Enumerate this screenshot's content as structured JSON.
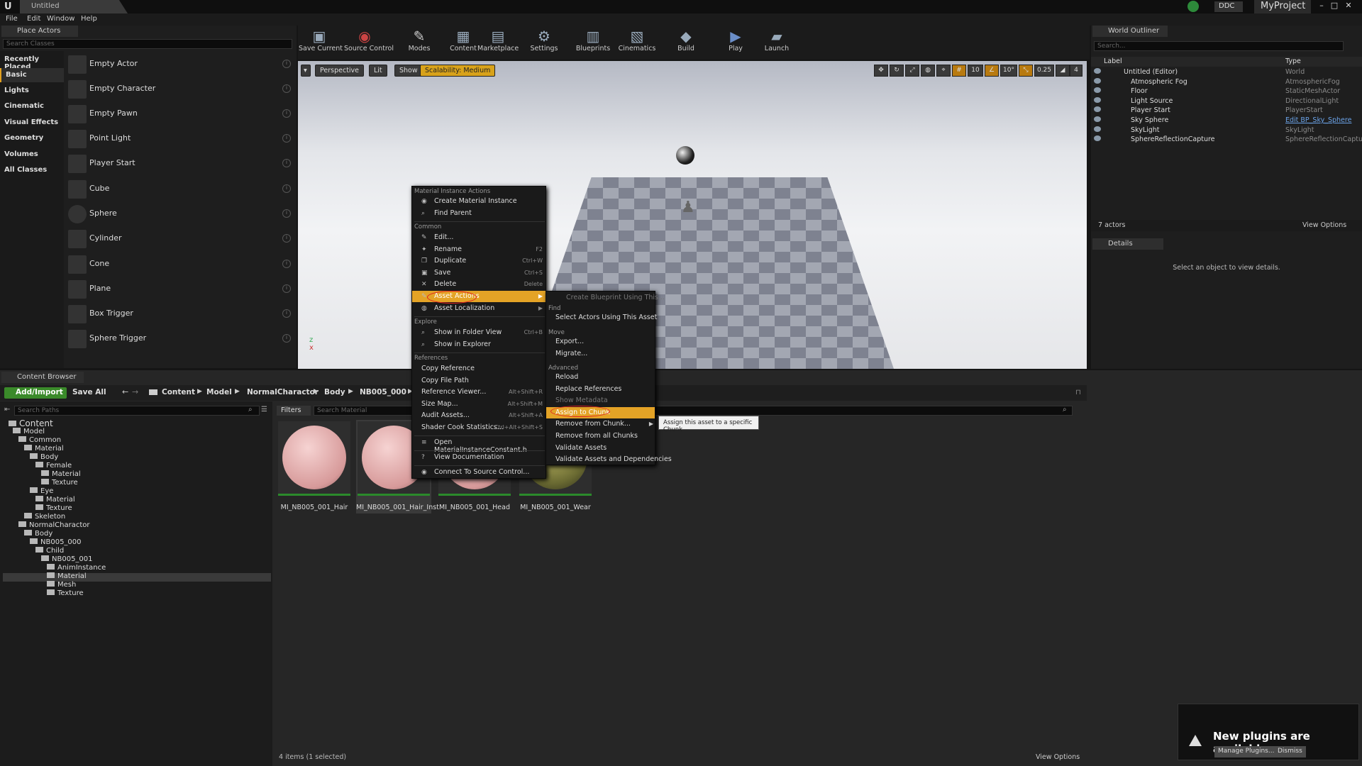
{
  "window": {
    "doc_tab": "Untitled",
    "ddc": "DDC",
    "project": "MyProject"
  },
  "menubar": [
    "File",
    "Edit",
    "Window",
    "Help"
  ],
  "place_actors": {
    "tab": "Place Actors",
    "search_placeholder": "Search Classes",
    "categories": [
      "Recently Placed",
      "Basic",
      "Lights",
      "Cinematic",
      "Visual Effects",
      "Geometry",
      "Volumes",
      "All Classes"
    ],
    "items": [
      "Empty Actor",
      "Empty Character",
      "Empty Pawn",
      "Point Light",
      "Player Start",
      "Cube",
      "Sphere",
      "Cylinder",
      "Cone",
      "Plane",
      "Box Trigger",
      "Sphere Trigger"
    ]
  },
  "toolbar": [
    "Save Current",
    "Source Control",
    "Modes",
    "Content",
    "Marketplace",
    "Settings",
    "Blueprints",
    "Cinematics",
    "Build",
    "Play",
    "Launch"
  ],
  "viewport": {
    "perspective": "Perspective",
    "lit": "Lit",
    "show": "Show",
    "scalability": "Scalability: Medium",
    "right": [
      "10",
      "10°",
      "0.25",
      "4"
    ]
  },
  "outliner": {
    "tab": "World Outliner",
    "search_placeholder": "Search...",
    "col_label": "Label",
    "col_type": "Type",
    "rows": [
      {
        "name": "Untitled (Editor)",
        "type": "World"
      },
      {
        "name": "Atmospheric Fog",
        "type": "AtmosphericFog"
      },
      {
        "name": "Floor",
        "type": "StaticMeshActor"
      },
      {
        "name": "Light Source",
        "type": "DirectionalLight"
      },
      {
        "name": "Player Start",
        "type": "PlayerStart"
      },
      {
        "name": "Sky Sphere",
        "type": "Edit BP_Sky_Sphere"
      },
      {
        "name": "SkyLight",
        "type": "SkyLight"
      },
      {
        "name": "SphereReflectionCapture",
        "type": "SphereReflectionCapture"
      }
    ],
    "count": "7 actors",
    "view_options": "View Options"
  },
  "details": {
    "tab": "Details",
    "message": "Select an object to view details."
  },
  "content_browser": {
    "tab": "Content Browser",
    "add_import": "Add/Import",
    "save_all": "Save All",
    "breadcrumb": [
      "Content",
      "Model",
      "NormalCharactor",
      "Body",
      "NB005_000"
    ],
    "tree_search_placeholder": "Search Paths",
    "filters": "Filters",
    "asset_search_placeholder": "Search Material",
    "tree": [
      "Content",
      "Model",
      "Common",
      "Material",
      "Body",
      "Female",
      "Material",
      "Texture",
      "Eye",
      "Material",
      "Texture",
      "Skeleton",
      "NormalCharactor",
      "Body",
      "NB005_000",
      "Child",
      "NB005_001",
      "AnimInstance",
      "Material",
      "Mesh",
      "Texture"
    ],
    "assets": [
      "MI_NB005_001_Hair",
      "MI_NB005_001_Hair_Inst",
      "MI_NB005_001_Head",
      "MI_NB005_001_Wear"
    ],
    "count": "4 items (1 selected)",
    "view_options": "View Options"
  },
  "context_menu": {
    "h_material": "Material Instance Actions",
    "create_mi": "Create Material Instance",
    "find_parent": "Find Parent",
    "h_common": "Common",
    "edit": "Edit...",
    "rename": "Rename",
    "rename_sc": "F2",
    "duplicate": "Duplicate",
    "duplicate_sc": "Ctrl+W",
    "save": "Save",
    "save_sc": "Ctrl+S",
    "delete": "Delete",
    "delete_sc": "Delete",
    "asset_actions": "Asset Actions",
    "asset_localization": "Asset Localization",
    "h_explore": "Explore",
    "show_folder": "Show in Folder View",
    "show_folder_sc": "Ctrl+B",
    "show_explorer": "Show in Explorer",
    "h_references": "References",
    "copy_ref": "Copy Reference",
    "copy_path": "Copy File Path",
    "ref_viewer": "Reference Viewer...",
    "ref_viewer_sc": "Alt+Shift+R",
    "size_map": "Size Map...",
    "size_map_sc": "Alt+Shift+M",
    "audit": "Audit Assets...",
    "audit_sc": "Alt+Shift+A",
    "shader_stats": "Shader Cook Statistics...",
    "shader_stats_sc": "Ctrl+Alt+Shift+S",
    "open_h": "Open MaterialInstanceConstant.h",
    "view_docs": "View Documentation",
    "connect_sc": "Connect To Source Control..."
  },
  "submenu": {
    "create_bp": "Create Blueprint Using This...",
    "h_find": "Find",
    "select_actors": "Select Actors Using This Asset",
    "h_move": "Move",
    "export": "Export...",
    "migrate": "Migrate...",
    "h_advanced": "Advanced",
    "reload": "Reload",
    "replace_refs": "Replace References",
    "show_metadata": "Show Metadata",
    "assign_chunk": "Assign to Chunk",
    "remove_chunk": "Remove from Chunk...",
    "remove_all": "Remove from all Chunks",
    "validate": "Validate Assets",
    "validate_deps": "Validate Assets and Dependencies"
  },
  "tooltip": "Assign this asset to a specific Chunk",
  "notification": {
    "title": "New plugins are available",
    "manage": "Manage Plugins...",
    "dismiss": "Dismiss"
  }
}
